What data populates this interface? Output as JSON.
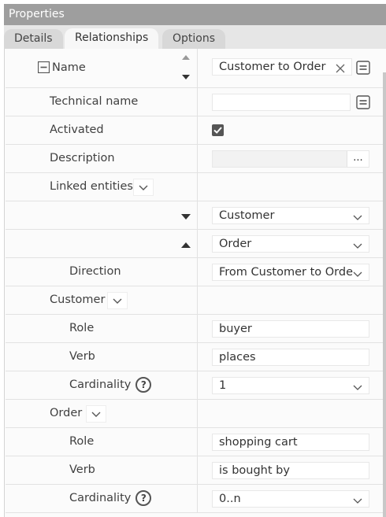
{
  "panel": {
    "title": "Properties"
  },
  "tabs": [
    "Details",
    "Relationships",
    "Options"
  ],
  "rows": {
    "name": {
      "label": "Name",
      "value": "Customer to Order"
    },
    "technical_name": {
      "label": "Technical name",
      "value": ""
    },
    "activated": {
      "label": "Activated",
      "checked": true
    },
    "description": {
      "label": "Description",
      "value": "",
      "more": "..."
    },
    "linked_entities": {
      "label": "Linked entities"
    },
    "entity_1": {
      "value": "Customer"
    },
    "entity_2": {
      "value": "Order"
    },
    "direction": {
      "label": "Direction",
      "value": "From Customer to Order"
    },
    "customer_group": {
      "label": "Customer"
    },
    "customer_role": {
      "label": "Role",
      "value": "buyer"
    },
    "customer_verb": {
      "label": "Verb",
      "value": "places"
    },
    "customer_cardinality": {
      "label": "Cardinality",
      "value": "1",
      "help": "?"
    },
    "order_group": {
      "label": "Order"
    },
    "order_role": {
      "label": "Role",
      "value": "shopping cart"
    },
    "order_verb": {
      "label": "Verb",
      "value": "is bought by"
    },
    "order_cardinality": {
      "label": "Cardinality",
      "value": "0..n",
      "help": "?"
    }
  },
  "icons": {
    "collapse": "minus-square-icon",
    "clear": "close-icon",
    "expression": "equals-box-icon",
    "dropdown": "chevron-down-icon",
    "sort_up": "triangle-up-icon",
    "sort_down": "triangle-down-icon"
  }
}
